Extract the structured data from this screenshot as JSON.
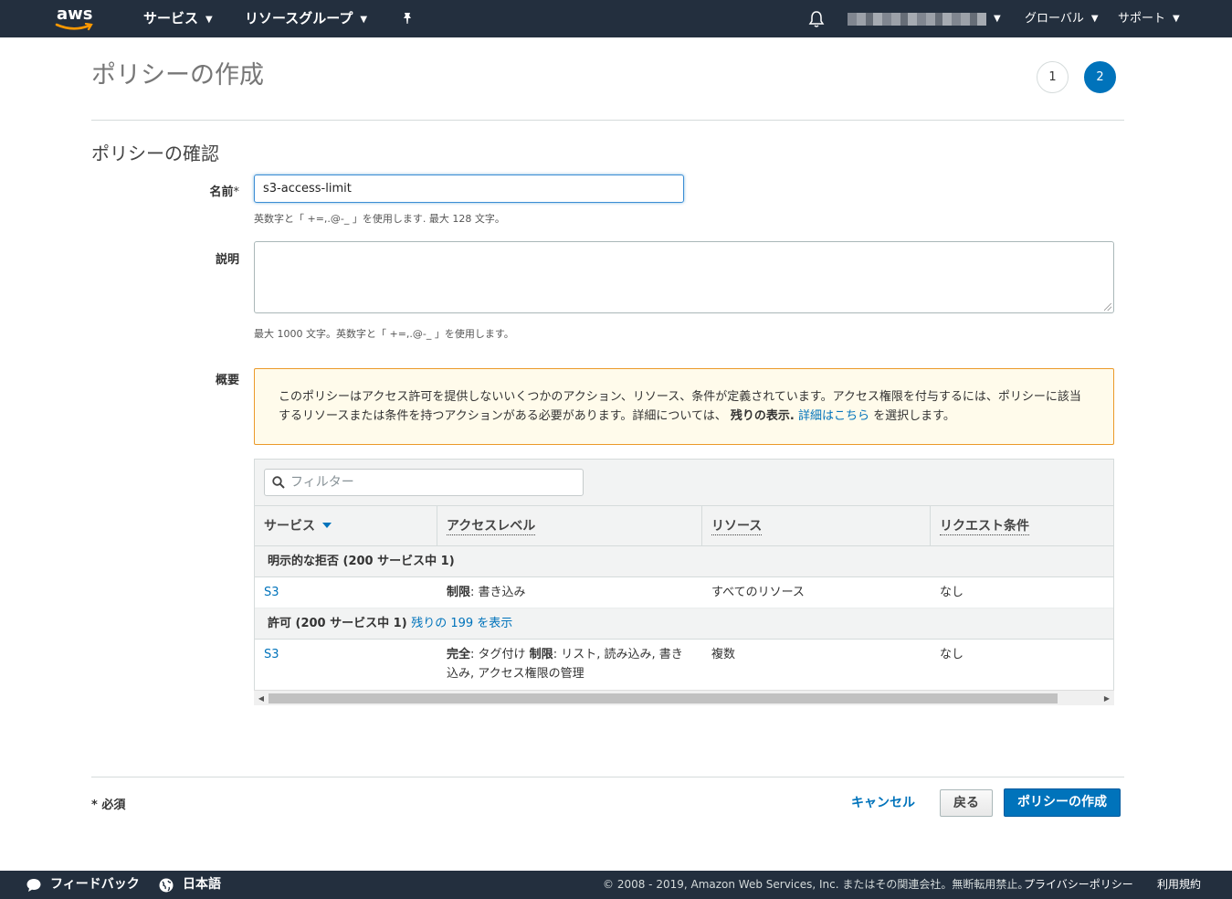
{
  "topnav": {
    "logo_text": "aws",
    "services": "サービス",
    "resource_groups": "リソースグループ",
    "region": "グローバル",
    "support": "サポート"
  },
  "header": {
    "title": "ポリシーの作成",
    "steps": [
      "1",
      "2"
    ],
    "active_step": 2
  },
  "review": {
    "section_title": "ポリシーの確認",
    "name_label": "名前",
    "name_required_mark": "*",
    "name_value": "s3-access-limit",
    "name_hint": "英数字と「 +=,.@-_ 」を使用します. 最大 128 文字。",
    "description_label": "説明",
    "description_value": "",
    "description_hint": "最大 1000 文字。英数字と「 +=,.@-_ 」を使用します。",
    "summary_label": "概要"
  },
  "info_box": {
    "text_part1": "このポリシーはアクセス許可を提供しないいくつかのアクション、リソース、条件が定義されています。アクセス権限を付与するには、ポリシーに該当するリソースまたは条件を持つアクションがある必要があります。詳細については、",
    "bold_text": "残りの表示.",
    "link_text": "詳細はこちら",
    "text_part2": "を選択します。"
  },
  "table": {
    "filter_placeholder": "フィルター",
    "columns": [
      "サービス",
      "アクセスレベル",
      "リソース",
      "リクエスト条件"
    ],
    "groups": [
      {
        "label": "明示的な拒否 (200 サービス中 1)",
        "link": "",
        "rows": [
          {
            "service": "S3",
            "access_bold": "制限",
            "access_rest": ": 書き込み",
            "access_bold2": "",
            "access_rest2": "",
            "resource": "すべてのリソース",
            "condition": "なし"
          }
        ]
      },
      {
        "label": "許可 (200 サービス中 1)",
        "link": "残りの 199 を表示",
        "rows": [
          {
            "service": "S3",
            "access_bold": "完全",
            "access_rest": ": タグ付け ",
            "access_bold2": "制限",
            "access_rest2": ": リスト, 読み込み, 書き込み, アクセス権限の管理",
            "resource": "複数",
            "condition": "なし"
          }
        ]
      }
    ]
  },
  "actions": {
    "required_note": "* 必須",
    "cancel": "キャンセル",
    "back": "戻る",
    "create": "ポリシーの作成"
  },
  "footer": {
    "feedback": "フィードバック",
    "language": "日本語",
    "copyright": "© 2008 - 2019, Amazon Web Services, Inc. またはその関連会社。無断転用禁止。",
    "privacy": "プライバシーポリシー",
    "terms": "利用規約"
  },
  "colors": {
    "nav_bg": "#232f3e",
    "primary": "#0073bb",
    "warning_border": "#eb9a2a",
    "warning_bg": "#fffbeb"
  }
}
